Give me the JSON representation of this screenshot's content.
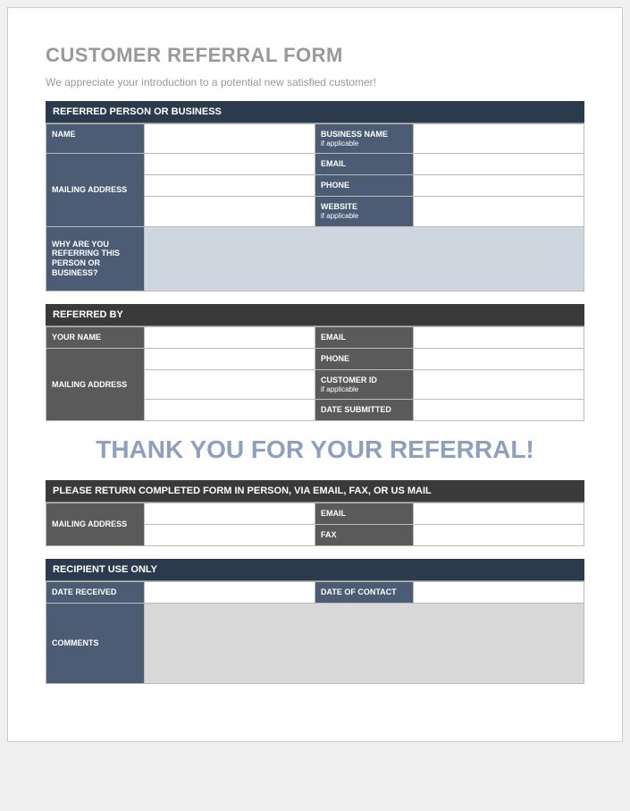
{
  "title": "CUSTOMER REFERRAL FORM",
  "subtitle": "We appreciate your introduction to a potential new satisfied customer!",
  "section1": {
    "header": "REFERRED PERSON OR BUSINESS",
    "name_label": "NAME",
    "mailing_label": "MAILING ADDRESS",
    "bizname_label": "BUSINESS NAME",
    "bizname_sub": "if applicable",
    "email_label": "EMAIL",
    "phone_label": "PHONE",
    "website_label": "WEBSITE",
    "website_sub": "if applicable",
    "why_label": "WHY ARE YOU REFERRING THIS PERSON OR BUSINESS?",
    "name_val": "",
    "mailing_val1": "",
    "mailing_val2": "",
    "mailing_val3": "",
    "bizname_val": "",
    "email_val": "",
    "phone_val": "",
    "website_val": "",
    "why_val": ""
  },
  "section2": {
    "header": "REFERRED BY",
    "yourname_label": "YOUR NAME",
    "mailing_label": "MAILING ADDRESS",
    "email_label": "EMAIL",
    "phone_label": "PHONE",
    "custid_label": "CUSTOMER ID",
    "custid_sub": "if applicable",
    "date_label": "DATE SUBMITTED",
    "yourname_val": "",
    "mailing_val1": "",
    "mailing_val2": "",
    "mailing_val3": "",
    "mailing_val4": "",
    "email_val": "",
    "phone_val": "",
    "custid_val": "",
    "date_val": ""
  },
  "thankyou": "THANK YOU FOR YOUR REFERRAL!",
  "section3": {
    "header": "PLEASE RETURN COMPLETED FORM IN PERSON, VIA EMAIL, FAX, OR US MAIL",
    "mailing_label": "MAILING ADDRESS",
    "email_label": "EMAIL",
    "fax_label": "FAX",
    "mailing_val1": "",
    "mailing_val2": "",
    "email_val": "",
    "fax_val": ""
  },
  "section4": {
    "header": "RECIPIENT USE ONLY",
    "datercv_label": "DATE RECEIVED",
    "datecontact_label": "DATE OF CONTACT",
    "comments_label": "COMMENTS",
    "datercv_val": "",
    "datecontact_val": "",
    "comments_val": ""
  }
}
